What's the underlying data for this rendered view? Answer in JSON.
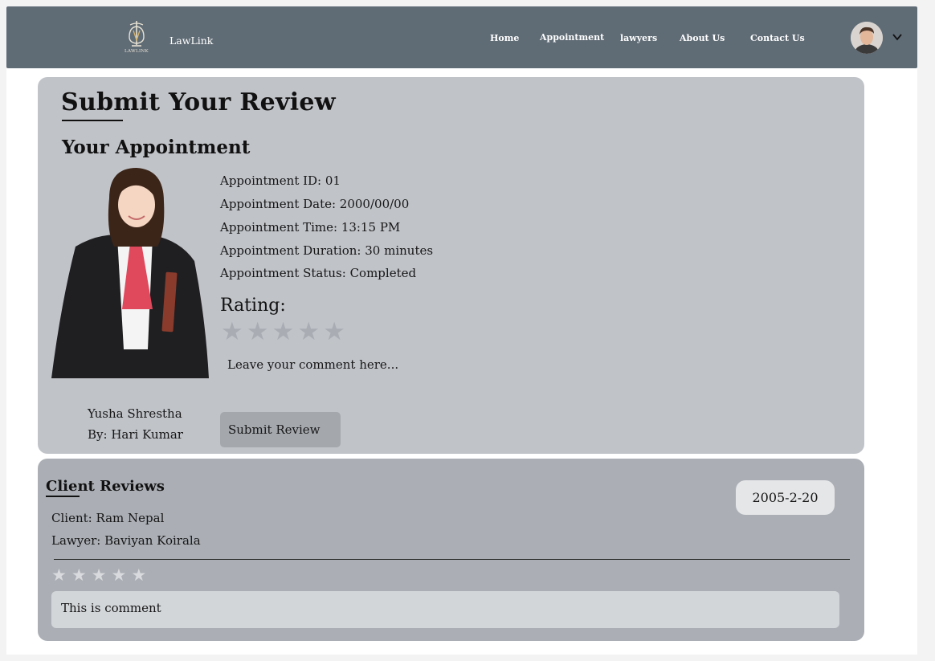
{
  "nav": {
    "logo_text": "LAWLINK",
    "brand": "LawLink",
    "links": [
      "Home",
      "Appointment",
      "lawyers",
      "About Us",
      "Contact Us"
    ]
  },
  "submit_section": {
    "title": "Submit Your Review",
    "subtitle": "Your Appointment",
    "appointment": {
      "id_line": "Appointment ID: 01",
      "date_line": "Appointment Date: 2000/00/00",
      "time_line": "Appointment Time: 13:15 PM",
      "duration_line": "Appointment Duration: 30 minutes",
      "status_line": "Appointment Status: Completed"
    },
    "rating_label": "Rating:",
    "rating_stars": [
      "★",
      "★",
      "★",
      "★",
      "★"
    ],
    "comment_placeholder": "Leave your comment here...",
    "lawyer_name": "Yusha Shrestha",
    "lawyer_by": "By: Hari Kumar",
    "submit_label": "Submit Review"
  },
  "reviews_section": {
    "title": "Client Reviews",
    "review": {
      "date": "2005-2-20",
      "client": "Client: Ram Nepal",
      "lawyer": "Lawyer: Baviyan Koirala",
      "stars": [
        "★",
        "★",
        "★",
        "★",
        "★"
      ],
      "comment": "This is comment"
    }
  },
  "colors": {
    "nav_bg": "#5f6b75",
    "card_submit_bg": "#c0c3c8",
    "card_reviews_bg": "#abafb5",
    "button_bg": "#a4a8ad"
  }
}
